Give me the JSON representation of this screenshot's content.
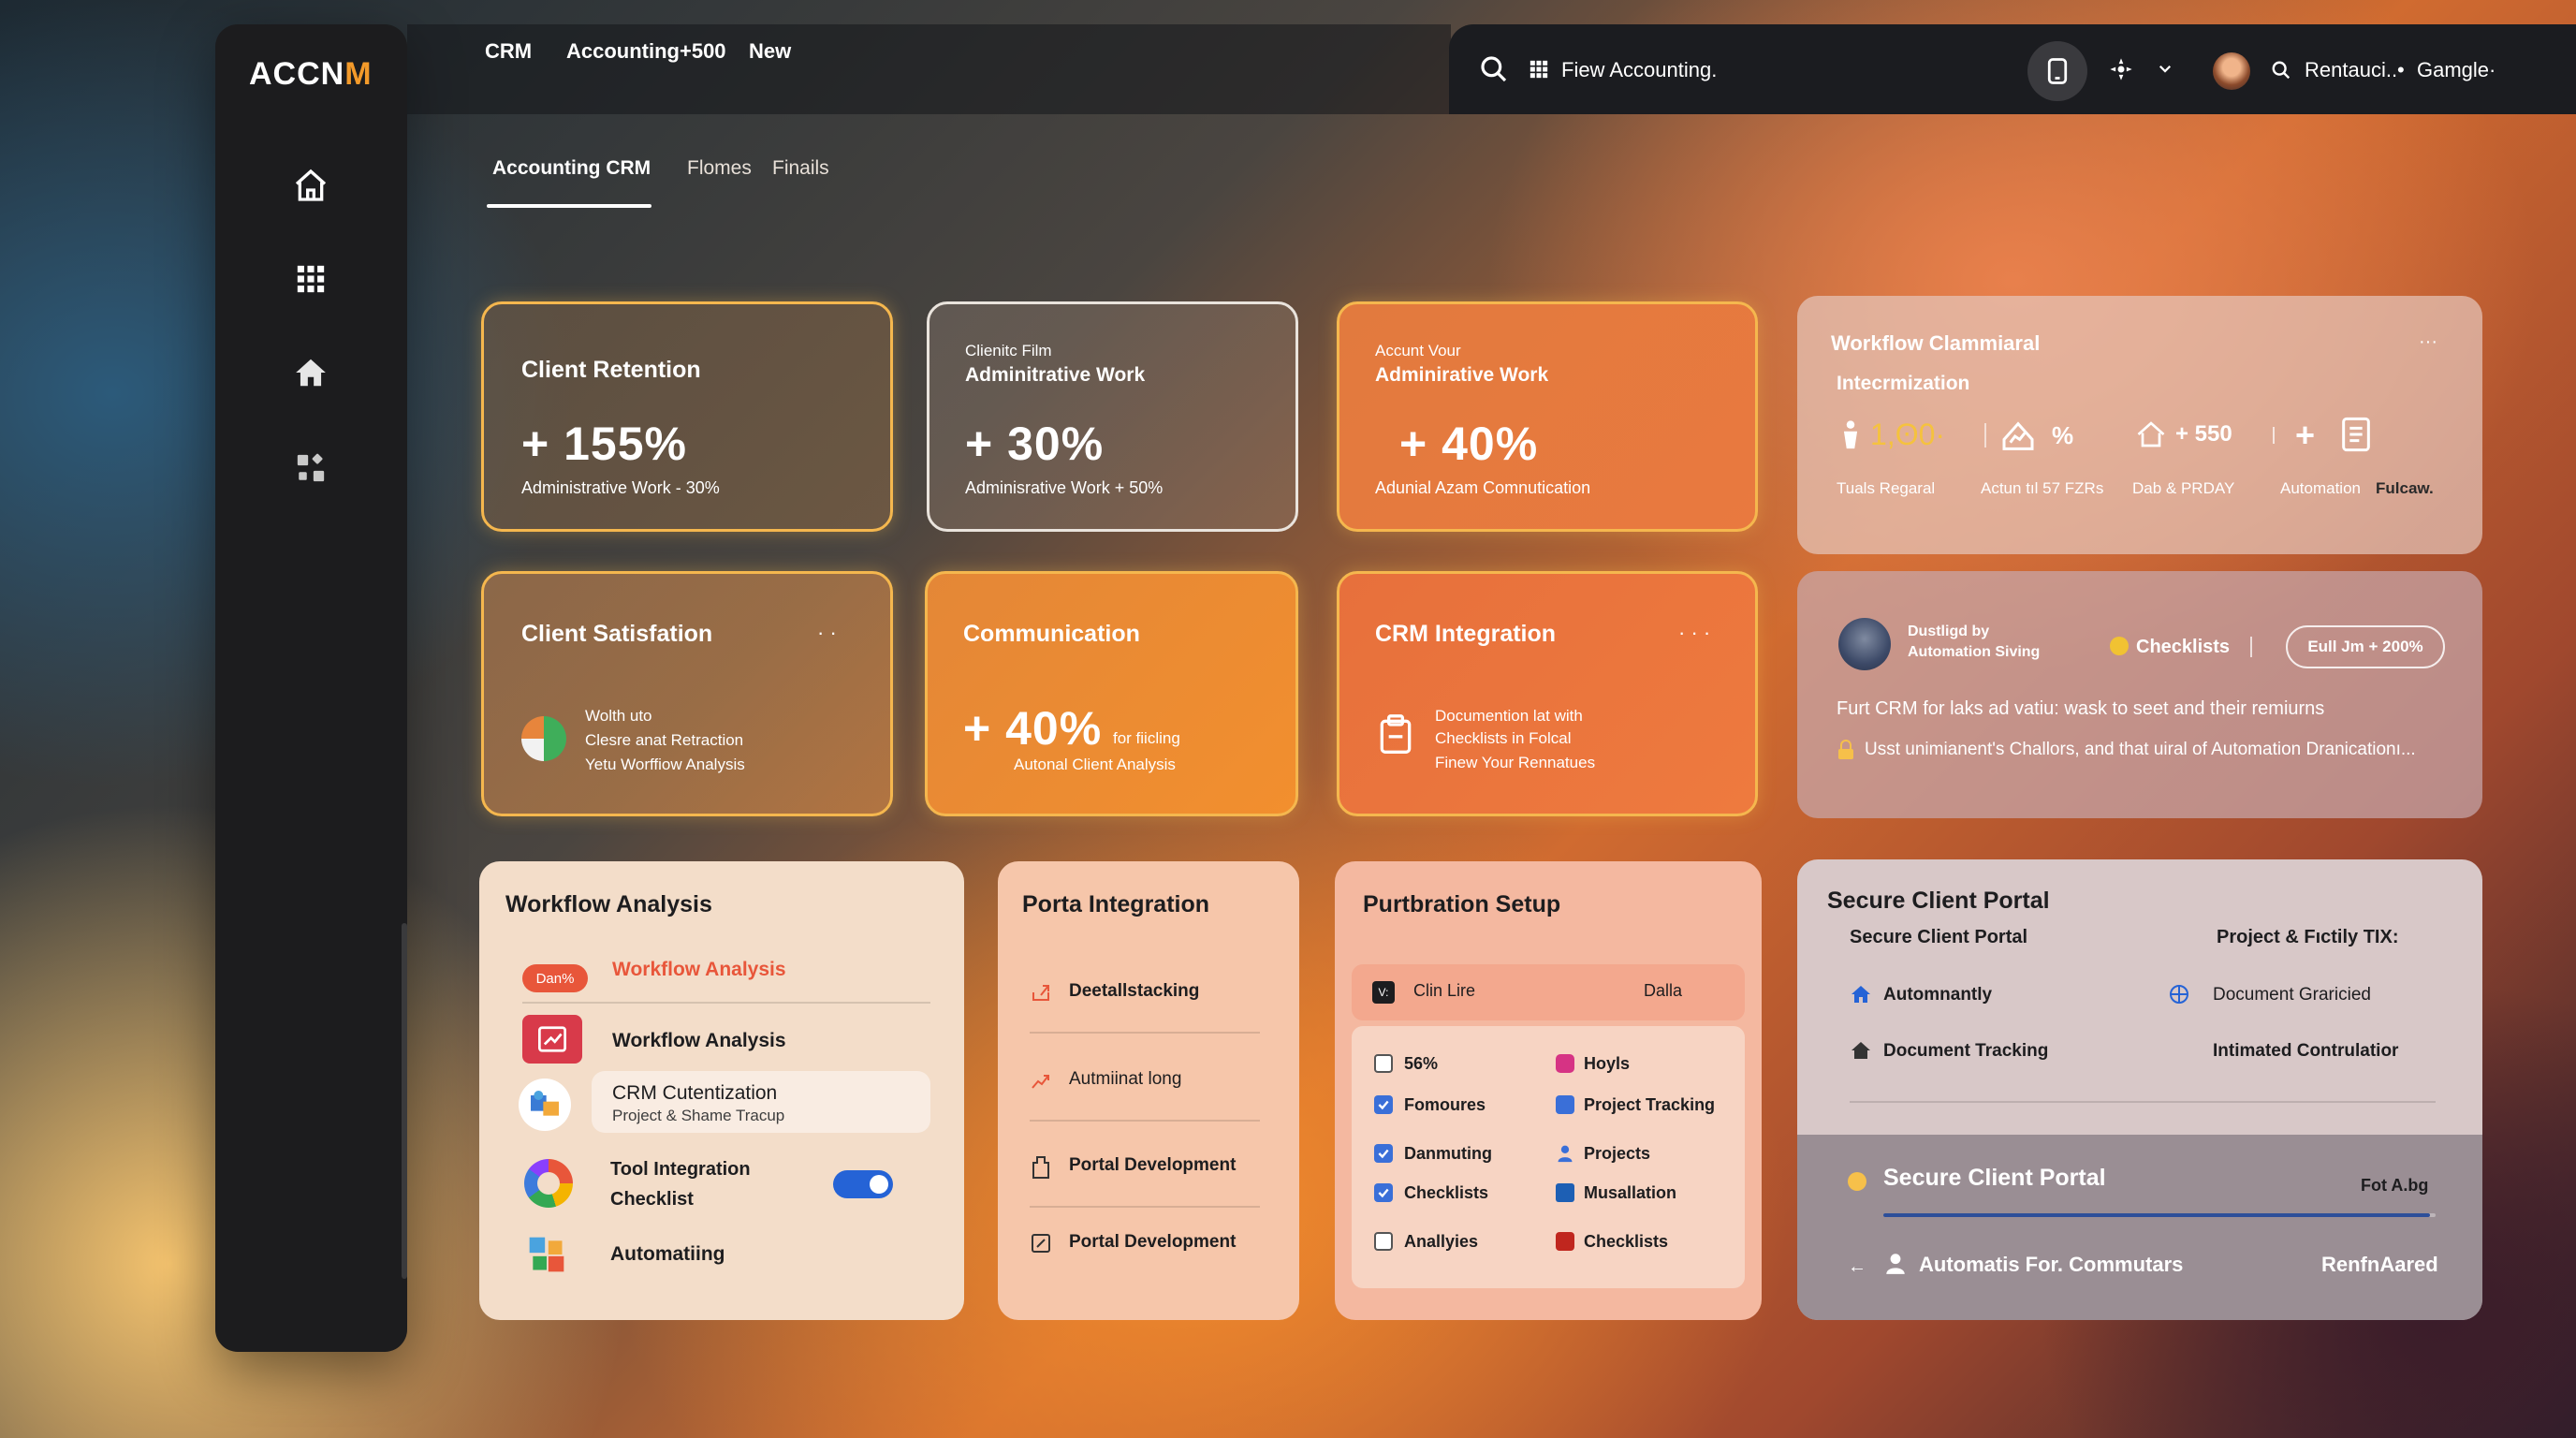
{
  "app": {
    "logo_prefix": "ACCN",
    "logo_accent": "M"
  },
  "topnav": {
    "items": [
      "CRM",
      "Accounting+500",
      "New"
    ]
  },
  "search": {
    "value": "Fiew Accounting.",
    "account_text": "Rentauci..•",
    "brand_text": "Gamgle·"
  },
  "subtabs": [
    "Accounting CRM",
    "Flomes",
    "Finails"
  ],
  "cards": {
    "retention": {
      "title": "Client Retention",
      "stat": "+ 155%",
      "sub": "Administrative Work - 30%"
    },
    "admin1": {
      "overline": "Clienitc Film",
      "title": "Adminitrative Work",
      "stat": "+ 30%",
      "sub": "Adminisrative Work + 50%"
    },
    "admin2": {
      "overline": "Accunt Vour",
      "title": "Adminirative Work",
      "stat": "+ 40%",
      "sub": "Adunial Azam Comnutication"
    },
    "satisfaction": {
      "title": "Client Satisfation",
      "menu": "· ·",
      "line1": "Wolth uto",
      "line2": "Clesre anat Retraction",
      "line3": "Yetu Worffiow Analysis"
    },
    "communication": {
      "title": "Communication",
      "stat": "+ 40%",
      "stat_suffix": "for fiicling",
      "sub": "Autonal Client Analysis"
    },
    "crm_integration": {
      "title": "CRM Integration",
      "menu": "· · ·",
      "line1": "Documention lat with",
      "line2": "Checklists in Folcal",
      "line3": "Finew Your Rennatues"
    }
  },
  "workflow_card": {
    "title": "Workflow Clammiaral",
    "menu": "···",
    "subtitle": "Intecrmization",
    "metrics": [
      {
        "value": "1,ʘ0·",
        "label": "Tuals Regaral"
      },
      {
        "value": "%",
        "label": "Actun tıl 57 FZRs"
      },
      {
        "value": "+ 550",
        "label": "Dab & PRDAY"
      },
      {
        "value": "+",
        "label": "Automation"
      }
    ],
    "extra_label": "Fulcaw."
  },
  "automation_card": {
    "name": "Dustligd by",
    "name2": "Automation Siving",
    "checklists": "Checklists",
    "badge": "Eull Jm + 200%",
    "text1": "Furt CRM for laks ad vatiu: wask to seet and their remiurns",
    "text2": "Usst unimianent's Challors, and that uiral of Automation Dranicationı..."
  },
  "workflow_panel": {
    "title": "Workflow Analysis",
    "badge": "Dan%",
    "items": [
      {
        "label": "Workflow Analysis"
      },
      {
        "label": "Workflow Analysis"
      },
      {
        "label": "CRM Cutentization",
        "sub": "Project & Shame Tracup"
      },
      {
        "label": "Tool Integration",
        "label2": "Checklist"
      },
      {
        "label": "Automatiing"
      }
    ],
    "toggle_on": true
  },
  "porta_panel": {
    "title": "Porta Integration",
    "items": [
      "Deetallstacking",
      "Autmiinat long",
      "Portal Development",
      "Portal Development"
    ]
  },
  "setup_panel": {
    "title": "Purtbration Setup",
    "header_left": "Clin Lire",
    "header_right": "Dalla",
    "left_items": [
      {
        "label": "56%",
        "checked": false
      },
      {
        "label": "Fomoures",
        "checked": true
      },
      {
        "label": "Danmuting",
        "checked": true
      },
      {
        "label": "Checklists",
        "checked": true
      },
      {
        "label": "Anallyies",
        "checked": false
      }
    ],
    "right_items": [
      {
        "label": "Hoyls",
        "color": "#d63384"
      },
      {
        "label": "Project Tracking",
        "color": "#3a6fd8"
      },
      {
        "label": "Projects",
        "color": "#3a6fd8"
      },
      {
        "label": "Musallation",
        "color": "#1d5fb4"
      },
      {
        "label": "Checklists",
        "color": "#c0261e"
      }
    ]
  },
  "portal_panel": {
    "title": "Secure Client Portal",
    "col_left_header": "Secure Client Portal",
    "col_right_header": "Project & Fıctily TIX:",
    "rows": [
      {
        "left": "Automnantly",
        "right": "Document Graricied"
      },
      {
        "left": "Document Tracking",
        "right": "Intimated Contrulatior"
      }
    ],
    "footer_title": "Secure Client Portal",
    "footer_right": "Fot A.bg",
    "footer_link": "Automatis For. Commutars",
    "footer_link_right": "RenfnAared",
    "progress": 0.99
  }
}
